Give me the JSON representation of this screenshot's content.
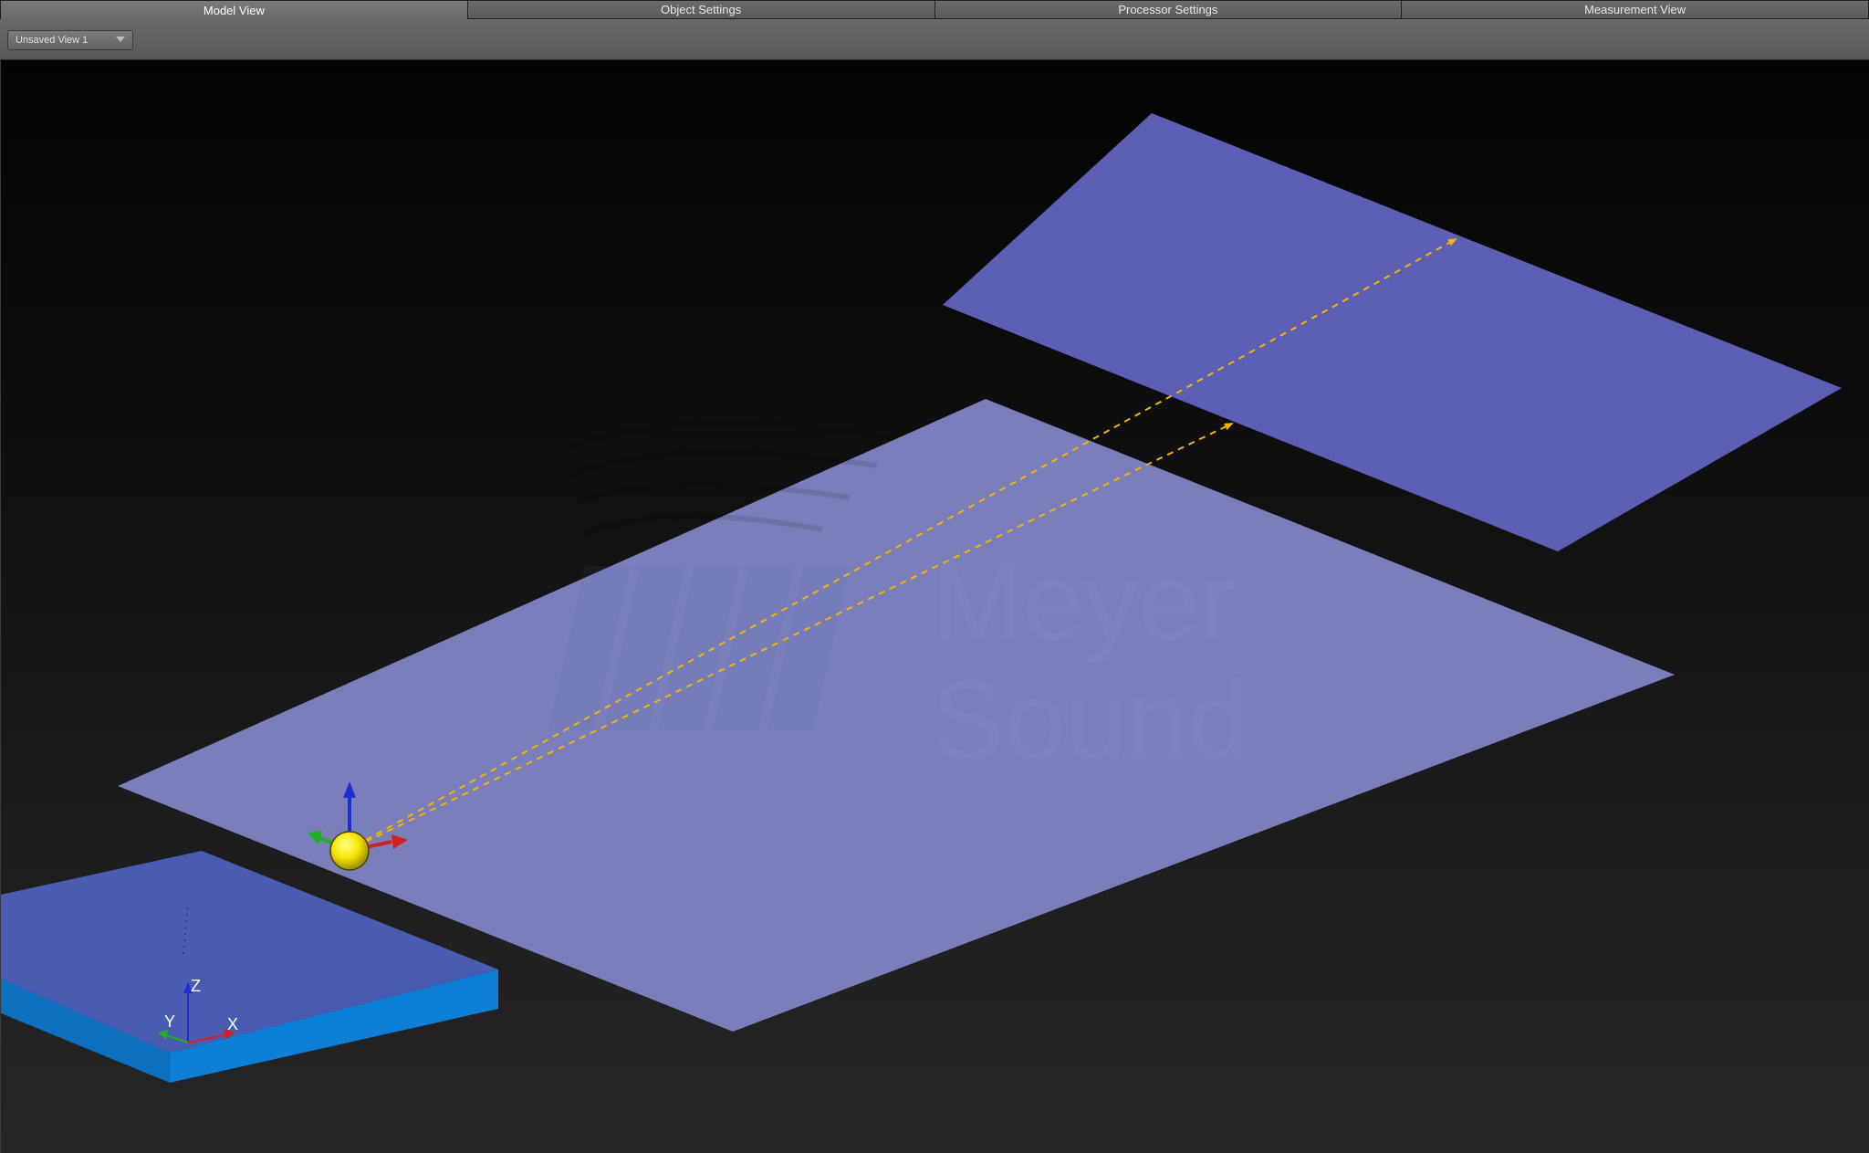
{
  "tabs": [
    {
      "label": "Model View",
      "active": true
    },
    {
      "label": "Object Settings",
      "active": false
    },
    {
      "label": "Processor Settings",
      "active": false
    },
    {
      "label": "Measurement View",
      "active": false
    }
  ],
  "toolbar": {
    "view_select_value": "Unsaved View 1"
  },
  "axes": {
    "x_label": "X",
    "y_label": "Y",
    "z_label": "Z"
  },
  "watermark": {
    "line1": "Meyer",
    "line2": "Sound"
  },
  "colors": {
    "main_surface": "#7a7fbc",
    "upper_surface": "#5c5fb3",
    "block_top": "#4a5cb2",
    "block_side": "#0e7fd6",
    "source_sphere": "#f4e400",
    "ray": "#f2b400",
    "axis_x": "#d02020",
    "axis_y": "#20b020",
    "axis_z": "#1a2fd8"
  }
}
